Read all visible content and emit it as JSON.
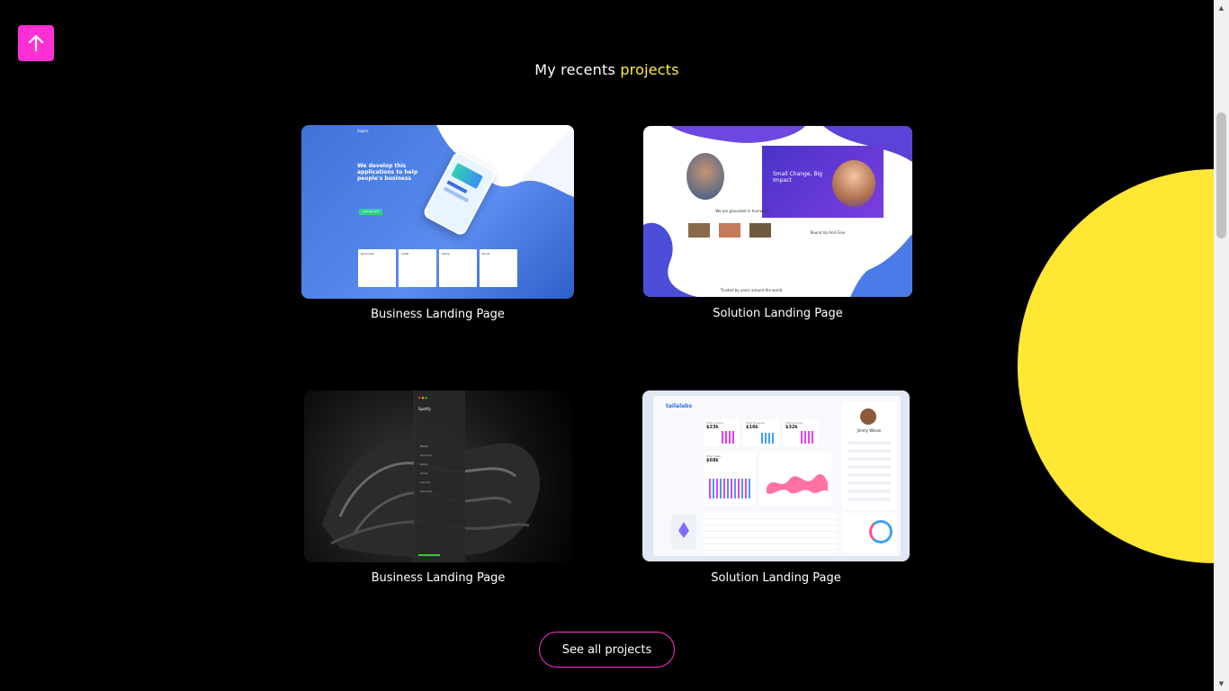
{
  "header": {
    "title_prefix": "My recents ",
    "title_highlight": "projects"
  },
  "scroll_top": {
    "icon": "arrow-up-icon"
  },
  "projects": [
    {
      "caption": "Business Landing Page",
      "preview": {
        "brand": "Aspire",
        "headline": "We develop this applications to help people's business",
        "cta": "Get started",
        "features": [
          "Dominant",
          "Initial",
          "Sharp",
          "Boost"
        ]
      }
    },
    {
      "caption": "Solution Landing Page",
      "preview": {
        "hero": "Small Change, Big Impact",
        "section1": "We are grounded in humanity",
        "section2": "Round Up And Give",
        "footer": "Trusted by users around the world"
      }
    },
    {
      "caption": "Business Landing Page",
      "preview": {
        "app_name": "Spotify",
        "menu": [
          "Home",
          "Discover",
          "Radio",
          "Artist",
          "Albums",
          "Podcasts"
        ]
      }
    },
    {
      "caption": "Solution Landing Page",
      "preview": {
        "brand": "tailalabs",
        "stat1_value": "$23k",
        "stat1_label": "Total Income",
        "stat2_value": "$16k",
        "stat2_label": "Total Expense",
        "stat3_value": "$32k",
        "stat3_label": "Total Earning",
        "profile_name": "Jimmy Wilson",
        "chart_label": "Total Sales",
        "chart_value": "$68k"
      }
    }
  ],
  "see_all_label": "See all projects",
  "colors": {
    "accent": "#ff2fd6",
    "highlight": "#ffef3a",
    "circle": "#ffe733"
  }
}
